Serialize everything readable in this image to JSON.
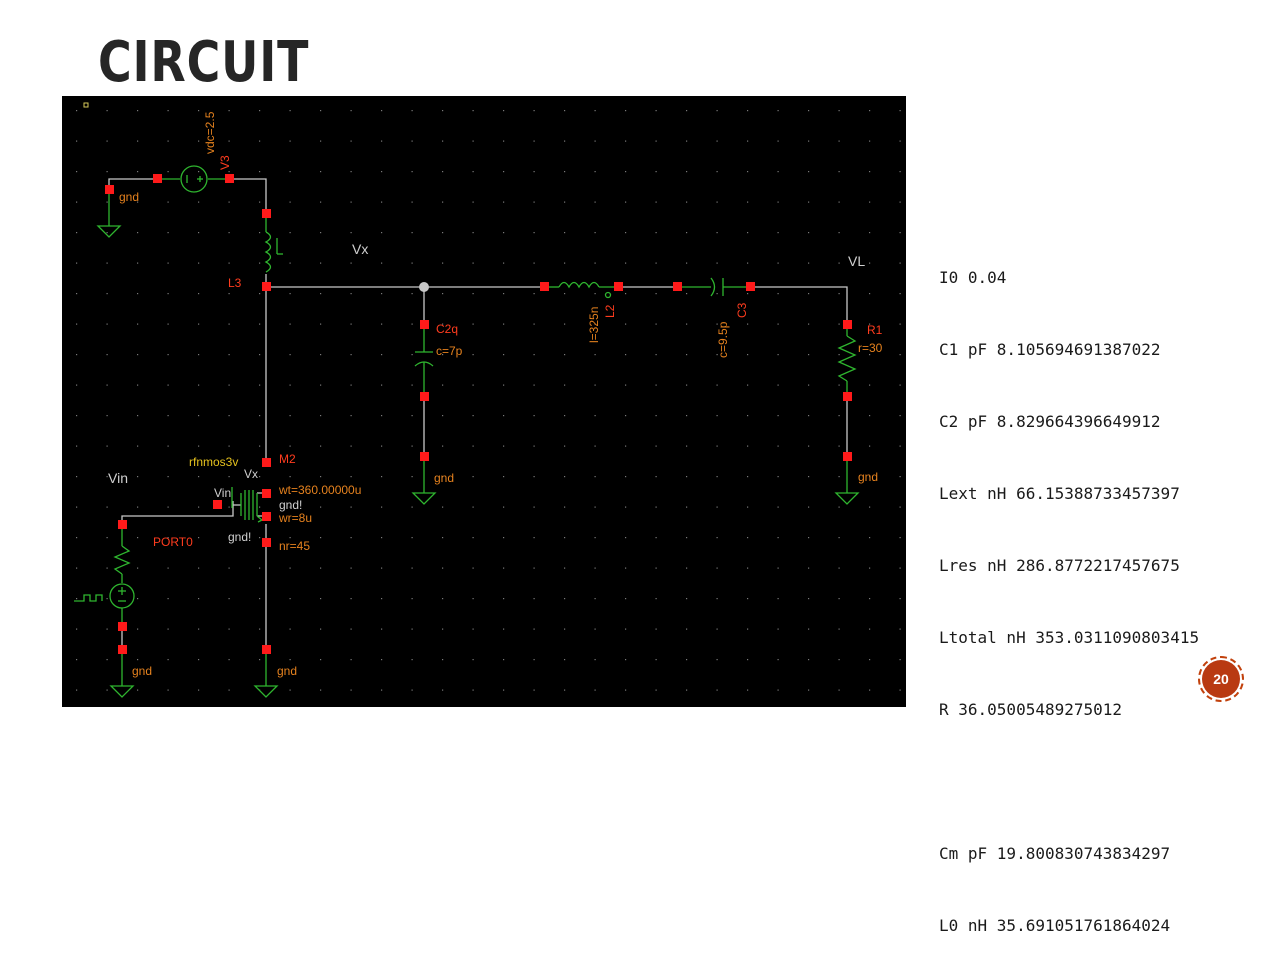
{
  "slide": {
    "title": "CIRCUIT",
    "page_number": "20"
  },
  "schematic": {
    "labels": {
      "v3_param": "vdc=2.5",
      "v3_name": "V3",
      "gnd_top": "gnd",
      "l3_name": "L3",
      "vx_net": "Vx",
      "vl_net": "VL",
      "c2q_name": "C2q",
      "c2q_value": "c=7p",
      "gnd_c2q": "gnd",
      "l2_value": "l=325n",
      "l2_name": "L2",
      "c3_value": "c=9.5p",
      "c3_name": "C3",
      "r1_name": "R1",
      "r1_value": "r=30",
      "gnd_r1": "gnd",
      "m2_model": "rfnmos3v",
      "m2_name": "M2",
      "m2_drain": "Vx",
      "vin_net": "Vin",
      "m2_gate": "Vin",
      "m2_wt": "wt=360.00000u",
      "m2_bulk": "gnd!",
      "m2_wr": "wr=8u",
      "m2_source": "gnd!",
      "m2_nr": "nr=45",
      "port_name": "PORT0",
      "gnd_port": "gnd",
      "gnd_m2": "gnd"
    }
  },
  "parameters": [
    "I0 0.04",
    "C1 pF 8.105694691387022",
    "C2 pF 8.829664396649912",
    "Lext nH 66.15388733457397",
    "Lres nH 286.8772217457675",
    "Ltotal nH 353.0311090803415",
    "R 36.05005489275012",
    "",
    "Cm pF 19.800830743834297",
    "L0 nH 35.691051761864024"
  ],
  "colors": {
    "schematic_bg": "#000000",
    "wire": "#c8c8c8",
    "symbol": "#2fb52f",
    "pin": "#ff1a1a",
    "instance_label": "#ff3c1e",
    "param_label": "#e6821e",
    "net_label": "#d0d0d0",
    "badge": "#b93a12"
  }
}
